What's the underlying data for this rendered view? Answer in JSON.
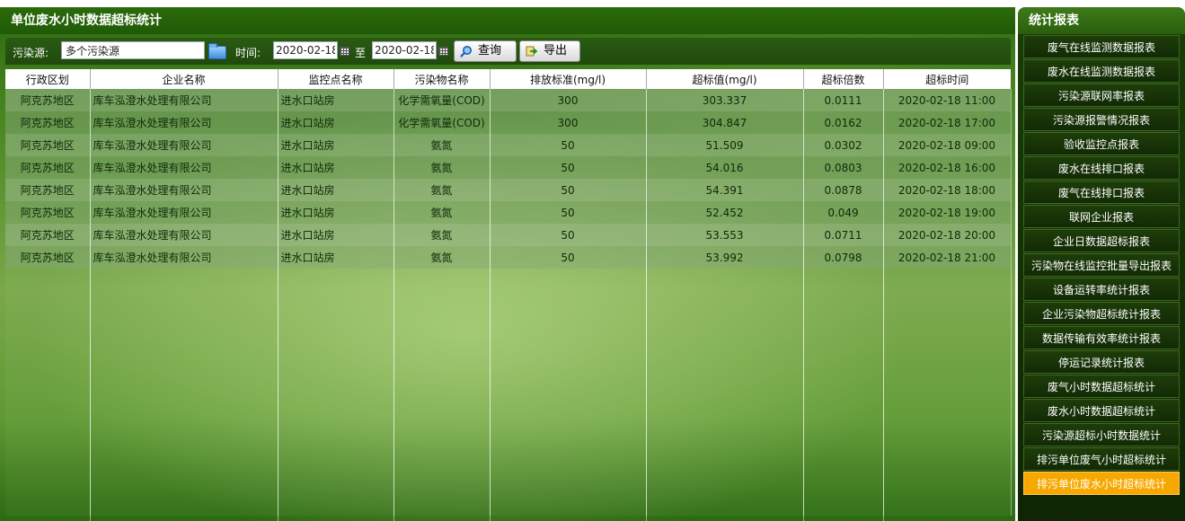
{
  "main": {
    "title": "单位废水小时数据超标统计"
  },
  "toolbar": {
    "pollution_source_label": "污染源:",
    "pollution_source_value": "多个污染源",
    "time_label": "时间:",
    "date_from": "2020-02-18",
    "to_label": "至",
    "date_to": "2020-02-18",
    "query_label": "查询",
    "export_label": "导出"
  },
  "table": {
    "columns": [
      "行政区划",
      "企业名称",
      "监控点名称",
      "污染物名称",
      "排放标准(mg/l)",
      "超标值(mg/l)",
      "超标倍数",
      "超标时间"
    ],
    "rows": [
      [
        "阿克苏地区",
        "库车泓澄水处理有限公司",
        "进水口站房",
        "化学需氧量(COD)",
        "300",
        "303.337",
        "0.0111",
        "2020-02-18 11:00"
      ],
      [
        "阿克苏地区",
        "库车泓澄水处理有限公司",
        "进水口站房",
        "化学需氧量(COD)",
        "300",
        "304.847",
        "0.0162",
        "2020-02-18 17:00"
      ],
      [
        "阿克苏地区",
        "库车泓澄水处理有限公司",
        "进水口站房",
        "氨氮",
        "50",
        "51.509",
        "0.0302",
        "2020-02-18 09:00"
      ],
      [
        "阿克苏地区",
        "库车泓澄水处理有限公司",
        "进水口站房",
        "氨氮",
        "50",
        "54.016",
        "0.0803",
        "2020-02-18 16:00"
      ],
      [
        "阿克苏地区",
        "库车泓澄水处理有限公司",
        "进水口站房",
        "氨氮",
        "50",
        "54.391",
        "0.0878",
        "2020-02-18 18:00"
      ],
      [
        "阿克苏地区",
        "库车泓澄水处理有限公司",
        "进水口站房",
        "氨氮",
        "50",
        "52.452",
        "0.049",
        "2020-02-18 19:00"
      ],
      [
        "阿克苏地区",
        "库车泓澄水处理有限公司",
        "进水口站房",
        "氨氮",
        "50",
        "53.553",
        "0.0711",
        "2020-02-18 20:00"
      ],
      [
        "阿克苏地区",
        "库车泓澄水处理有限公司",
        "进水口站房",
        "氨氮",
        "50",
        "53.992",
        "0.0798",
        "2020-02-18 21:00"
      ]
    ]
  },
  "sidebar": {
    "title": "统计报表",
    "active_index": 18,
    "items": [
      "废气在线监测数据报表",
      "废水在线监测数据报表",
      "污染源联网率报表",
      "污染源报警情况报表",
      "验收监控点报表",
      "废水在线排口报表",
      "废气在线排口报表",
      "联网企业报表",
      "企业日数据超标报表",
      "污染物在线监控批量导出报表",
      "设备运转率统计报表",
      "企业污染物超标统计报表",
      "数据传输有效率统计报表",
      "停运记录统计报表",
      "废气小时数据超标统计",
      "废水小时数据超标统计",
      "污染源超标小时数据统计",
      "排污单位废气小时超标统计",
      "排污单位废水小时超标统计"
    ]
  },
  "colors": {
    "accent": "#f7a800",
    "header_green": "#2b6b0b"
  }
}
